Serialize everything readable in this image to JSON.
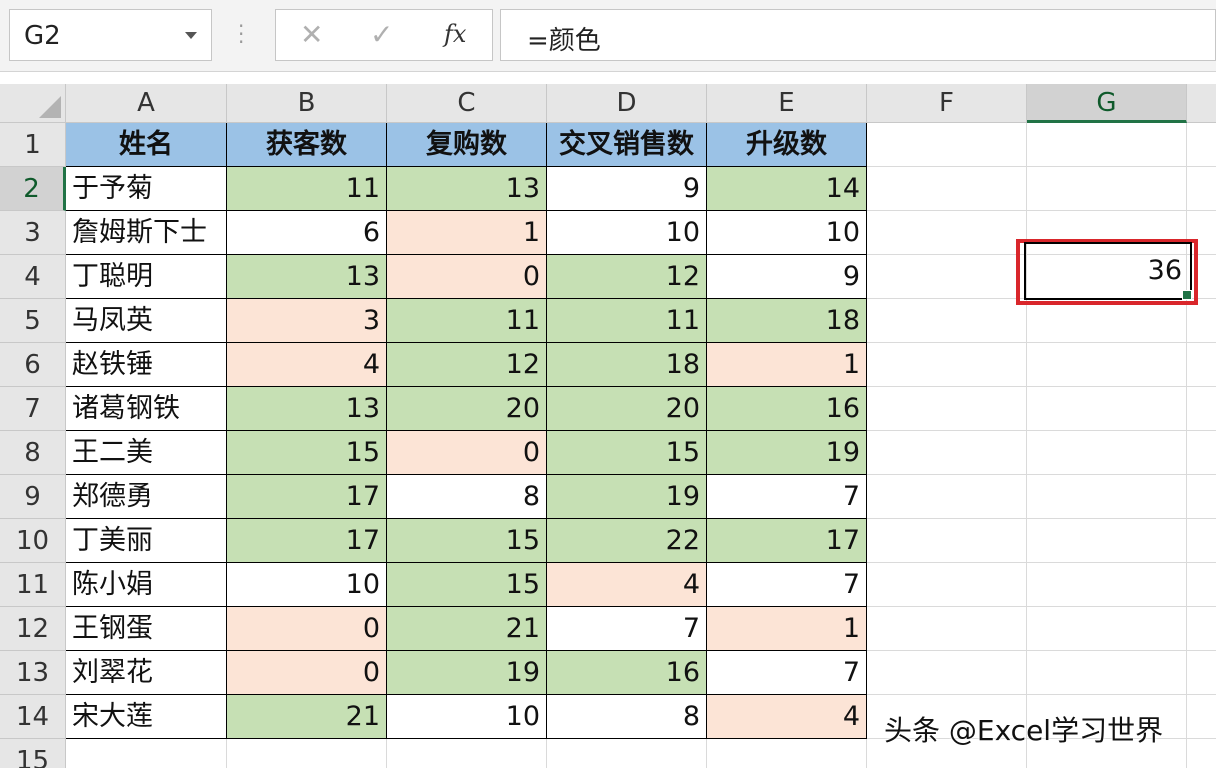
{
  "formula_bar": {
    "name_box": "G2",
    "cancel_glyph": "✕",
    "enter_glyph": "✓",
    "fx_label": "fx",
    "formula": "=颜色"
  },
  "columns": [
    "A",
    "B",
    "C",
    "D",
    "E",
    "F",
    "G"
  ],
  "selected_column": "G",
  "rows": [
    "1",
    "2",
    "3",
    "4",
    "5",
    "6",
    "7",
    "8",
    "9",
    "10",
    "11",
    "12",
    "13",
    "14",
    "15"
  ],
  "selected_row": "2",
  "table": {
    "headers": [
      "姓名",
      "获客数",
      "复购数",
      "交叉销售数",
      "升级数"
    ],
    "records": [
      {
        "name": "于予菊",
        "values": [
          "11",
          "13",
          "9",
          "14"
        ],
        "fills": [
          "green",
          "green",
          "none",
          "green"
        ]
      },
      {
        "name": "詹姆斯下士",
        "values": [
          "6",
          "1",
          "10",
          "10"
        ],
        "fills": [
          "none",
          "pink",
          "none",
          "none"
        ]
      },
      {
        "name": "丁聪明",
        "values": [
          "13",
          "0",
          "12",
          "9"
        ],
        "fills": [
          "green",
          "pink",
          "green",
          "none"
        ]
      },
      {
        "name": "马凤英",
        "values": [
          "3",
          "11",
          "11",
          "18"
        ],
        "fills": [
          "pink",
          "green",
          "green",
          "green"
        ]
      },
      {
        "name": "赵铁锤",
        "values": [
          "4",
          "12",
          "18",
          "1"
        ],
        "fills": [
          "pink",
          "green",
          "green",
          "pink"
        ]
      },
      {
        "name": "诸葛钢铁",
        "values": [
          "13",
          "20",
          "20",
          "16"
        ],
        "fills": [
          "green",
          "green",
          "green",
          "green"
        ]
      },
      {
        "name": "王二美",
        "values": [
          "15",
          "0",
          "15",
          "19"
        ],
        "fills": [
          "green",
          "pink",
          "green",
          "green"
        ]
      },
      {
        "name": "郑德勇",
        "values": [
          "17",
          "8",
          "19",
          "7"
        ],
        "fills": [
          "green",
          "none",
          "green",
          "none"
        ]
      },
      {
        "name": "丁美丽",
        "values": [
          "17",
          "15",
          "22",
          "17"
        ],
        "fills": [
          "green",
          "green",
          "green",
          "green"
        ]
      },
      {
        "name": "陈小娟",
        "values": [
          "10",
          "15",
          "4",
          "7"
        ],
        "fills": [
          "none",
          "green",
          "pink",
          "none"
        ]
      },
      {
        "name": "王钢蛋",
        "values": [
          "0",
          "21",
          "7",
          "1"
        ],
        "fills": [
          "pink",
          "green",
          "none",
          "pink"
        ]
      },
      {
        "name": "刘翠花",
        "values": [
          "0",
          "19",
          "16",
          "7"
        ],
        "fills": [
          "pink",
          "green",
          "green",
          "none"
        ]
      },
      {
        "name": "宋大莲",
        "values": [
          "21",
          "10",
          "8",
          "4"
        ],
        "fills": [
          "green",
          "none",
          "none",
          "pink"
        ]
      }
    ]
  },
  "active_cell": {
    "address": "G2",
    "value": "36"
  },
  "colors": {
    "header_fill": "#9bc2e6",
    "green_fill": "#c6e0b4",
    "pink_fill": "#fce4d6",
    "highlight_frame": "#d9262b",
    "excel_green": "#217346"
  },
  "watermark": "头条 @Excel学习世界"
}
